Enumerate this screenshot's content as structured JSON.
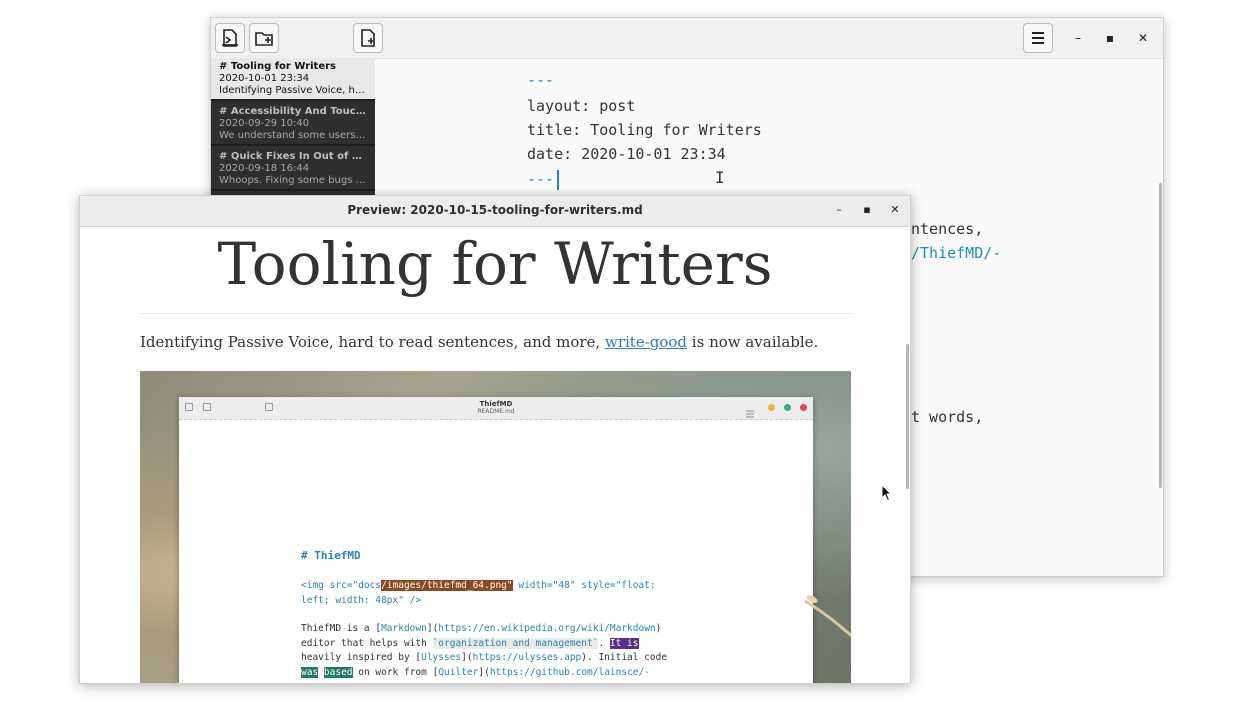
{
  "editor": {
    "toolbar_icons": [
      "open-sheets-icon",
      "new-folder-icon",
      "new-sheet-icon"
    ],
    "menu_icon": "hamburger-menu-icon",
    "window_controls": {
      "minimize": "–",
      "maximize": "▪",
      "close": "✕"
    },
    "sheets": [
      {
        "title": "# Tooling for Writers",
        "date": "2020-10-01 23:34",
        "snippet": "Identifying Passive Voice, hard to read sentences, and more"
      },
      {
        "title": "# Accessibility And Touch-Ups",
        "date": "2020-09-29 10:40",
        "snippet": "We understand some users use"
      },
      {
        "title": "# Quick Fixes In Out of Box Experience",
        "date": "2020-09-18 16:44",
        "snippet": "Whoops. Fixing some bugs found"
      }
    ],
    "lines": {
      "l1": "---",
      "l2": "layout: post",
      "l3": "title: Tooling for Writers",
      "l4": "date: 2020-10-01 23:34",
      "l5": "---",
      "l6": "ntences,",
      "l7": "/ThiefMD/-",
      "l8": "t words,"
    },
    "cursor_glyph": "I"
  },
  "preview": {
    "title": "Preview: 2020-10-15-tooling-for-writers.md",
    "window_controls": {
      "minimize": "–",
      "maximize": "▪",
      "close": "✕"
    },
    "heading": "Tooling for Writers",
    "paragraph_before": "Identifying Passive Voice, hard to read sentences, and more, ",
    "link_text": "write-good",
    "paragraph_after": " is now available.",
    "image": {
      "app_title": "ThiefMD",
      "app_subtitle": "README.md",
      "md_heading": "# ThiefMD",
      "code": {
        "a1": "<img src=\"docs",
        "a2": "/images/thiefmd_64.png\"",
        "a3": " width=\"48\" style=\"float:",
        "b1": "left; width: 48px\" />",
        "c1": "ThiefMD is a [",
        "c2": "Markdown",
        "c3": "](",
        "c4": "https://en.wikipedia.org/wiki/Markdown",
        "c5": ")",
        "d1": "editor that helps with ",
        "d2": "`organization and management`",
        "d3": ". ",
        "d4": "It is",
        "e1": "heavily inspired by [",
        "e2": "Ulysses",
        "e3": "](",
        "e4": "https://ulysses.app",
        "e5": "). Initial code",
        "f1": "was",
        "f2": "based",
        "f3": " on work from [",
        "f4": "Quilter",
        "f5": "](",
        "f6": "https://github.com/lainsce/-"
      },
      "dot_colors": [
        "#f0b43c",
        "#2ab07b",
        "#e8454a"
      ]
    }
  },
  "mouse_pointer_icon": "arrow-cursor-icon"
}
